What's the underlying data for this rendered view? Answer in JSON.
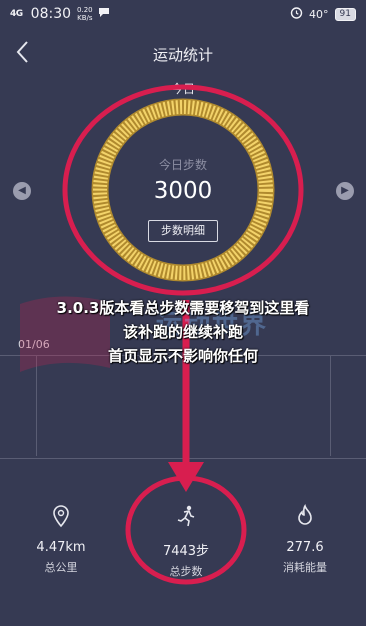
{
  "status_bar": {
    "network": "4G",
    "time": "08:30",
    "speed_value": "0.20",
    "speed_unit": "KB/s",
    "temperature": "40°",
    "battery": "91"
  },
  "nav": {
    "title": "运动统计"
  },
  "summary": {
    "period_label": "今日",
    "ring_label": "今日步数",
    "steps_value": "3000",
    "detail_button": "步数明细"
  },
  "overlay": {
    "line1": "3.0.3版本看总步数需要移驾到这里看",
    "line2": "该补跑的继续补跑",
    "line3": "首页显示不影响你任何",
    "watermark": "运动世界"
  },
  "chart": {
    "date_label": "01/06"
  },
  "stats": [
    {
      "icon": "location-pin-icon",
      "value": "4.47km",
      "label": "总公里"
    },
    {
      "icon": "runner-icon",
      "value": "7443步",
      "label": "总步数"
    },
    {
      "icon": "flame-icon",
      "value": "277.6",
      "label": "消耗能量"
    }
  ],
  "colors": {
    "background": "#363a53",
    "ring_gold": "#e8c04a",
    "annotation_red": "#d81e4f"
  }
}
